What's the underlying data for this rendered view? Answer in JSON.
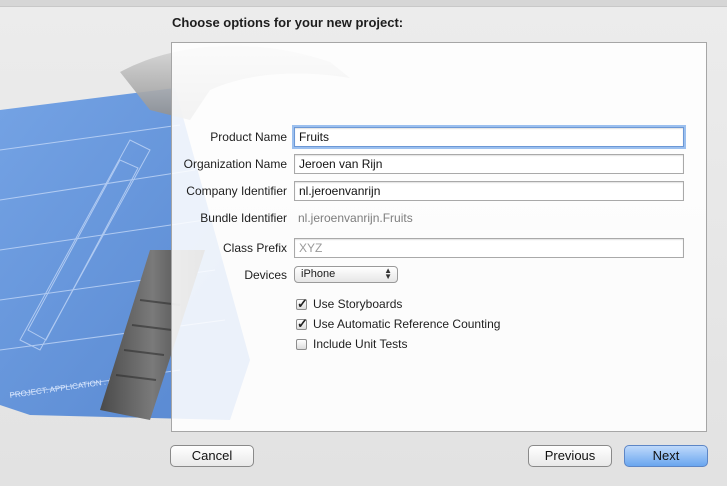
{
  "window": {
    "title": "Choose options for your new project:"
  },
  "form": {
    "product_name": {
      "label": "Product Name",
      "value": "Fruits"
    },
    "organization_name": {
      "label": "Organization Name",
      "value": "Jeroen van Rijn"
    },
    "company_identifier": {
      "label": "Company Identifier",
      "value": "nl.jeroenvanrijn"
    },
    "bundle_identifier": {
      "label": "Bundle Identifier",
      "value": "nl.jeroenvanrijn.Fruits"
    },
    "class_prefix": {
      "label": "Class Prefix",
      "placeholder": "XYZ"
    },
    "devices": {
      "label": "Devices",
      "value": "iPhone"
    },
    "options": [
      {
        "label": "Use Storyboards",
        "checked": true
      },
      {
        "label": "Use Automatic Reference Counting",
        "checked": true
      },
      {
        "label": "Include Unit Tests",
        "checked": false
      }
    ]
  },
  "buttons": {
    "cancel": "Cancel",
    "previous": "Previous",
    "next": "Next"
  },
  "artwork": {
    "icon": "hammer-blueprint-icon",
    "footer_text": "PROJECT: APPLICATION . APP"
  },
  "colors": {
    "blueprint": "#5b8fd8",
    "focus": "#9cc0ef",
    "next_button": "#6aa6ef"
  }
}
